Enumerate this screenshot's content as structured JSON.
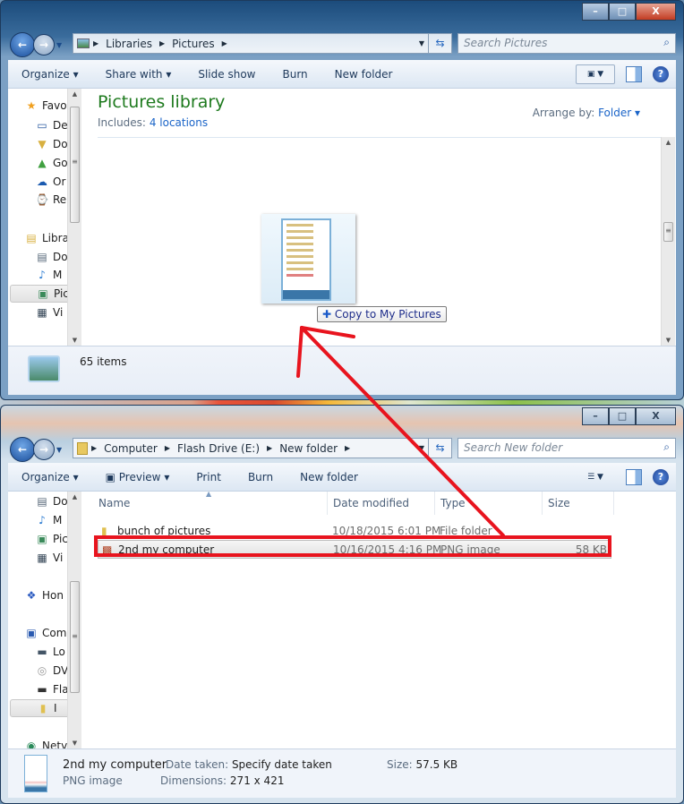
{
  "window_top": {
    "address": [
      "Libraries",
      "Pictures"
    ],
    "search_placeholder": "Search Pictures",
    "toolbar": [
      "Organize",
      "Share with",
      "Slide show",
      "Burn",
      "New folder"
    ],
    "nav": [
      {
        "label": "Favo",
        "icon": "star-icon"
      },
      {
        "label": "De",
        "icon": "desktop-icon"
      },
      {
        "label": "Do",
        "icon": "downloads-icon"
      },
      {
        "label": "Go",
        "icon": "google-drive-icon"
      },
      {
        "label": "Or",
        "icon": "onedrive-icon"
      },
      {
        "label": "Re",
        "icon": "recent-places-icon"
      },
      {
        "label": "Libra",
        "icon": "libraries-icon"
      },
      {
        "label": "Do",
        "icon": "documents-icon"
      },
      {
        "label": "M",
        "icon": "music-icon"
      },
      {
        "label": "Pic",
        "icon": "pictures-icon"
      },
      {
        "label": "Vi",
        "icon": "videos-icon"
      }
    ],
    "library_title": "Pictures library",
    "includes_label": "Includes:",
    "includes_link": "4 locations",
    "arrange_label": "Arrange by:",
    "arrange_value": "Folder",
    "drag_tooltip": "Copy to My Pictures",
    "status": "65 items"
  },
  "window_bottom": {
    "address": [
      "Computer",
      "Flash Drive (E:)",
      "New folder"
    ],
    "search_placeholder": "Search New folder",
    "toolbar": [
      "Organize",
      "Preview",
      "Print",
      "Burn",
      "New folder"
    ],
    "nav": [
      {
        "label": "Do",
        "icon": "documents-icon"
      },
      {
        "label": "M",
        "icon": "music-icon"
      },
      {
        "label": "Pic",
        "icon": "pictures-icon"
      },
      {
        "label": "Vi",
        "icon": "videos-icon"
      },
      {
        "label": "Hon",
        "icon": "homegroup-icon"
      },
      {
        "label": "Com",
        "icon": "computer-icon"
      },
      {
        "label": "Lo",
        "icon": "local-disk-icon"
      },
      {
        "label": "DV",
        "icon": "dvd-drive-icon"
      },
      {
        "label": "Fla",
        "icon": "flash-drive-icon"
      },
      {
        "label": "I",
        "icon": "folder-icon"
      },
      {
        "label": "Netv",
        "icon": "network-icon"
      }
    ],
    "columns": [
      "Name",
      "Date modified",
      "Type",
      "Size"
    ],
    "files": [
      {
        "name": "bunch of pictures",
        "date": "10/18/2015 6:01 PM",
        "type": "File folder",
        "size": "",
        "icon": "folder-icon"
      },
      {
        "name": "2nd my computer",
        "date": "10/16/2015 4:16 PM",
        "type": "PNG image",
        "size": "58 KB",
        "icon": "png-image-icon"
      }
    ],
    "details": {
      "name": "2nd my computer",
      "type": "PNG image",
      "date_taken_label": "Date taken:",
      "date_taken": "Specify date taken",
      "dimensions_label": "Dimensions:",
      "dimensions": "271 x 421",
      "size_label": "Size:",
      "size": "57.5 KB"
    }
  },
  "annotation_color": "#e8141e"
}
